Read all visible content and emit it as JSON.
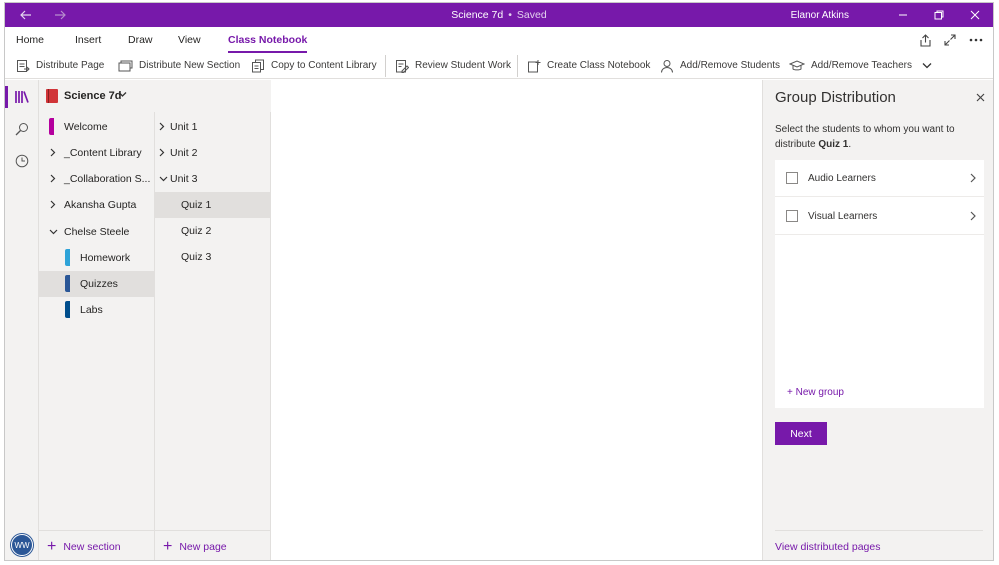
{
  "titlebar": {
    "title": "Science 7d",
    "separator": "•",
    "status": "Saved",
    "user": "Elanor Atkins",
    "back_icon": "arrow-left-icon",
    "forward_icon": "arrow-right-icon"
  },
  "ribbon_tabs": [
    {
      "label": "Home"
    },
    {
      "label": "Insert"
    },
    {
      "label": "Draw"
    },
    {
      "label": "View"
    },
    {
      "label": "Class Notebook"
    }
  ],
  "ribbon_commands": [
    {
      "label": "Distribute Page",
      "icon": "distribute-page-icon"
    },
    {
      "label": "Distribute New Section",
      "icon": "distribute-section-icon"
    },
    {
      "label": "Copy to Content Library",
      "icon": "copy-library-icon"
    },
    {
      "label": "Review Student Work",
      "icon": "review-work-icon"
    },
    {
      "label": "Create Class Notebook",
      "icon": "create-notebook-icon"
    },
    {
      "label": "Add/Remove Students",
      "icon": "person-icon"
    },
    {
      "label": "Add/Remove Teachers",
      "icon": "graduation-cap-icon"
    }
  ],
  "notebook": {
    "name": "Science 7d"
  },
  "sections": [
    {
      "label": "Welcome",
      "color": "#b4009e"
    },
    {
      "label": "_Content Library"
    },
    {
      "label": "_Collaboration S..."
    },
    {
      "label": "Akansha Gupta"
    },
    {
      "label": "Chelse Steele"
    },
    {
      "label": "Homework",
      "color": "#2ea3d8"
    },
    {
      "label": "Quizzes",
      "color": "#2b5797"
    },
    {
      "label": "Labs",
      "color": "#004e8c"
    }
  ],
  "pages": [
    {
      "label": "Unit 1"
    },
    {
      "label": "Unit 2"
    },
    {
      "label": "Unit 3"
    },
    {
      "label": "Quiz 1"
    },
    {
      "label": "Quiz 2"
    },
    {
      "label": "Quiz 3"
    }
  ],
  "footer": {
    "new_section": "New section",
    "new_page": "New page"
  },
  "avatar": {
    "initials": "WW",
    "color": "#2b5797"
  },
  "panel": {
    "title": "Group Distribution",
    "desc_prefix": "Select the students to whom you want to distribute ",
    "desc_bold": "Quiz 1",
    "desc_suffix": ".",
    "groups": [
      {
        "label": "Audio Learners",
        "checked": false
      },
      {
        "label": "Visual Learners",
        "checked": false
      }
    ],
    "new_group": "+ New group",
    "next_label": "Next",
    "view_distributed": "View distributed pages"
  },
  "colors": {
    "accent": "#7719aa"
  }
}
